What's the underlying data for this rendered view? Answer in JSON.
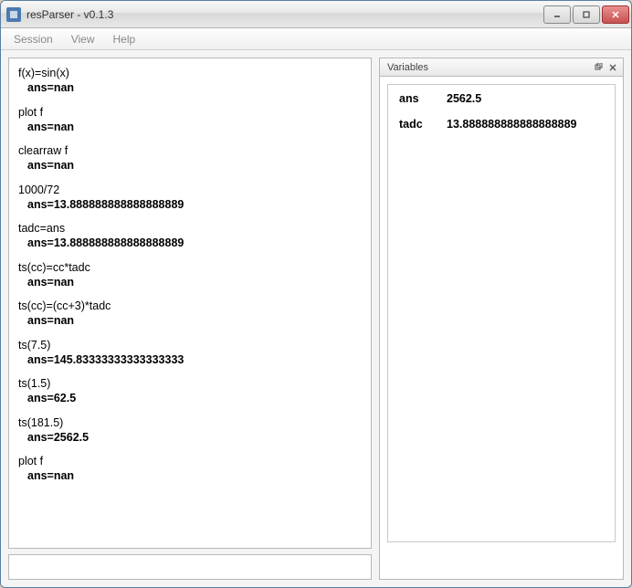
{
  "window": {
    "title": "resParser - v0.1.3"
  },
  "menu": {
    "session": "Session",
    "view": "View",
    "help": "Help"
  },
  "console": {
    "entries": [
      {
        "input": "f(x)=sin(x)",
        "output": "ans=nan"
      },
      {
        "input": "plot f",
        "output": "ans=nan"
      },
      {
        "input": "clearraw f",
        "output": "ans=nan"
      },
      {
        "input": "1000/72",
        "output": "ans=13.888888888888888889"
      },
      {
        "input": "tadc=ans",
        "output": "ans=13.888888888888888889"
      },
      {
        "input": "ts(cc)=cc*tadc",
        "output": "ans=nan"
      },
      {
        "input": "ts(cc)=(cc+3)*tadc",
        "output": "ans=nan"
      },
      {
        "input": "ts(7.5)",
        "output": "ans=145.83333333333333333"
      },
      {
        "input": "ts(1.5)",
        "output": "ans=62.5"
      },
      {
        "input": "ts(181.5)",
        "output": "ans=2562.5"
      },
      {
        "input": "plot f",
        "output": "ans=nan"
      }
    ]
  },
  "variables": {
    "title": "Variables",
    "items": [
      {
        "name": "ans",
        "value": "2562.5"
      },
      {
        "name": "tadc",
        "value": "13.888888888888888889"
      }
    ]
  }
}
